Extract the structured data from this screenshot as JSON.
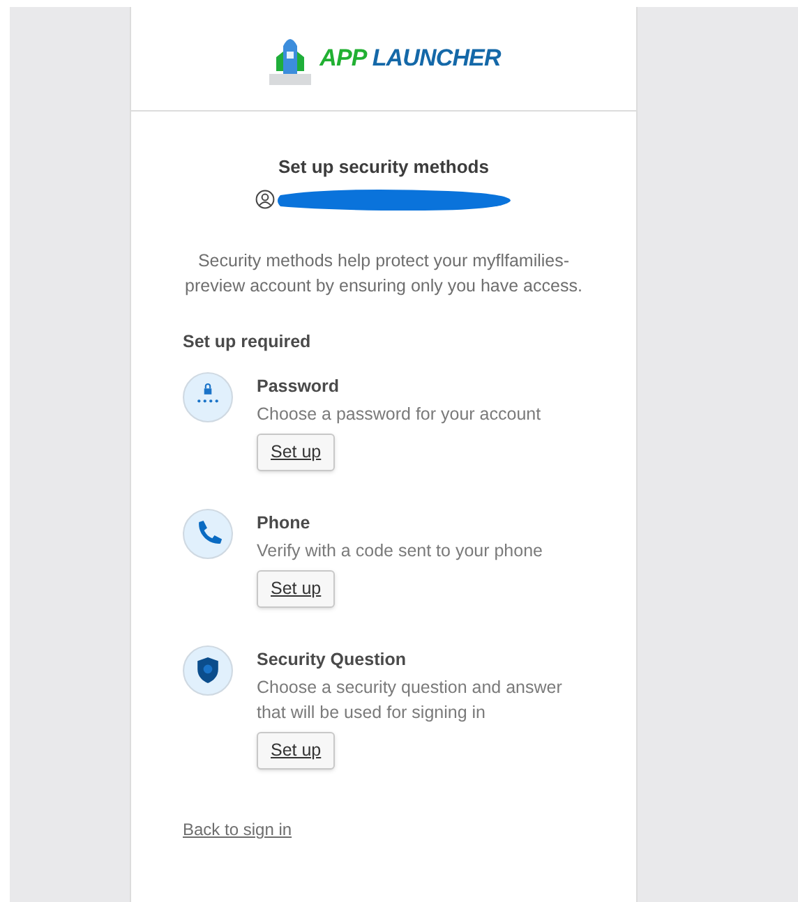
{
  "logo": {
    "word_1": "APP",
    "word_2": "LAUNCHER"
  },
  "title": "Set up security methods",
  "intro": "Security methods help protect your myflfamilies-preview account by ensuring only you have access.",
  "section_heading": "Set up required",
  "methods": [
    {
      "kind": "password",
      "name": "Password",
      "description": "Choose a password for your account",
      "button": "Set up"
    },
    {
      "kind": "phone",
      "name": "Phone",
      "description": "Verify with a code sent to your phone",
      "button": "Set up"
    },
    {
      "kind": "question",
      "name": "Security Question",
      "description": "Choose a security question and answer that will be used for signing in",
      "button": "Set up"
    }
  ],
  "back_link": "Back to sign in"
}
